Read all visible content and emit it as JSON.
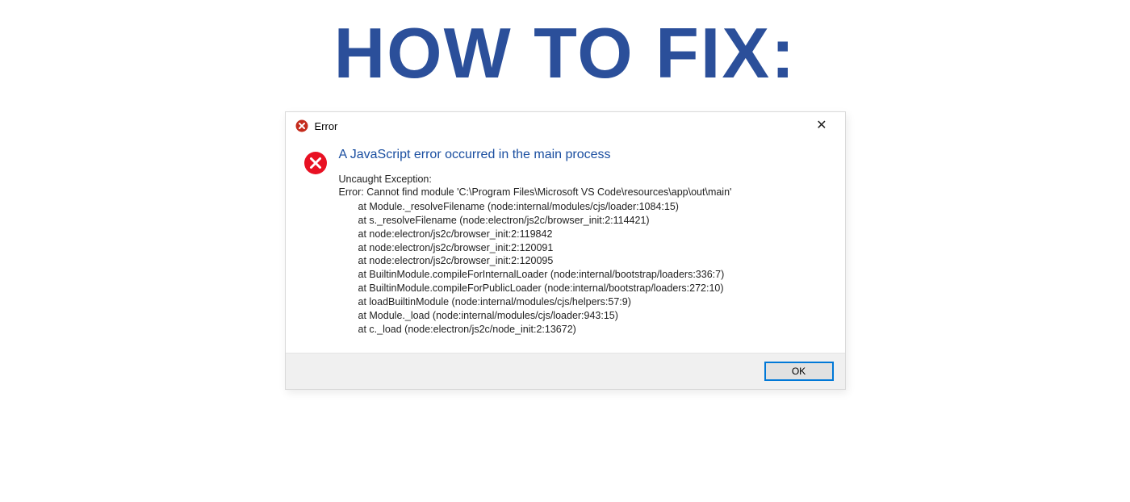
{
  "headline": "HOW TO FIX:",
  "dialog": {
    "window_title": "Error",
    "heading": "A JavaScript error occurred in the main process",
    "sub_heading": "Uncaught Exception:",
    "error_message": "Error: Cannot find module 'C:\\Program Files\\Microsoft VS Code\\resources\\app\\out\\main'",
    "stack": [
      "at Module._resolveFilename (node:internal/modules/cjs/loader:1084:15)",
      "at s._resolveFilename (node:electron/js2c/browser_init:2:114421)",
      "at node:electron/js2c/browser_init:2:119842",
      "at node:electron/js2c/browser_init:2:120091",
      "at node:electron/js2c/browser_init:2:120095",
      "at BuiltinModule.compileForInternalLoader (node:internal/bootstrap/loaders:336:7)",
      "at BuiltinModule.compileForPublicLoader (node:internal/bootstrap/loaders:272:10)",
      "at loadBuiltinModule (node:internal/modules/cjs/helpers:57:9)",
      "at Module._load (node:internal/modules/cjs/loader:943:15)",
      "at c._load (node:electron/js2c/node_init:2:13672)"
    ],
    "ok_label": "OK"
  }
}
